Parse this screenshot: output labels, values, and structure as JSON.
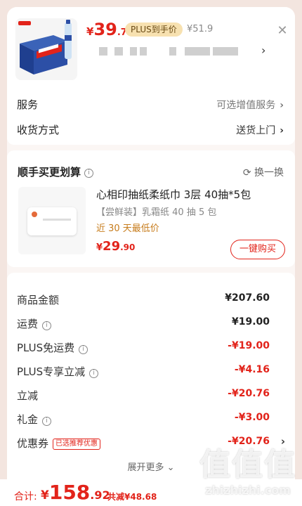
{
  "product": {
    "price_symbol": "¥",
    "price_int": "39",
    "price_dec": ".73",
    "plus_badge": "PLUS到手价",
    "original_price": "¥51.9",
    "close_icon": "close-icon",
    "spec_chevron": "›"
  },
  "rows": {
    "service": {
      "label": "服务",
      "value": "可选增值服务",
      "chevron": "›"
    },
    "delivery": {
      "label": "收货方式",
      "value": "送货上门",
      "chevron": "›"
    }
  },
  "addon": {
    "title": "顺手买更划算",
    "info_icon": "i",
    "refresh_label": "⟳ 换一换",
    "name": "心相印抽纸柔纸巾 3层 40抽*5包",
    "subtitle": "【尝鲜装】乳霜纸 40 抽 5 包",
    "low_price_note": "近 30 天最低价",
    "price_symbol": "¥",
    "price_int": "29",
    "price_dec": ".90",
    "buy_button": "一键购买"
  },
  "summary": {
    "rows": [
      {
        "label": "商品金额",
        "amount": "¥207.60",
        "negative": false,
        "info": false
      },
      {
        "label": "运费",
        "amount": "¥19.00",
        "negative": false,
        "info": true
      },
      {
        "label": "PLUS免运费",
        "amount": "-¥19.00",
        "negative": true,
        "info": true
      },
      {
        "label": "PLUS专享立减",
        "amount": "-¥4.16",
        "negative": true,
        "info": true
      },
      {
        "label": "立减",
        "amount": "-¥20.76",
        "negative": true,
        "info": false
      },
      {
        "label": "礼金",
        "amount": "-¥3.00",
        "negative": true,
        "info": true
      },
      {
        "label": "优惠券",
        "amount": "-¥20.76",
        "negative": true,
        "info": false
      }
    ],
    "coupon_tag": "已选推荐优惠",
    "coupon_chevron": "›",
    "expand_label": "展开更多 ⌄"
  },
  "bottom": {
    "total_label": "合计:",
    "price_symbol": "¥",
    "price_int": "158",
    "price_dec": ".92",
    "saved": "共减¥48.68"
  },
  "watermark": {
    "big": "值值值",
    "small": "zhizhizhi.com"
  },
  "colors": {
    "accent_red": "#e2231a",
    "plus_gold": "#f7e1b0",
    "low_price_orange": "#c77c1c"
  }
}
